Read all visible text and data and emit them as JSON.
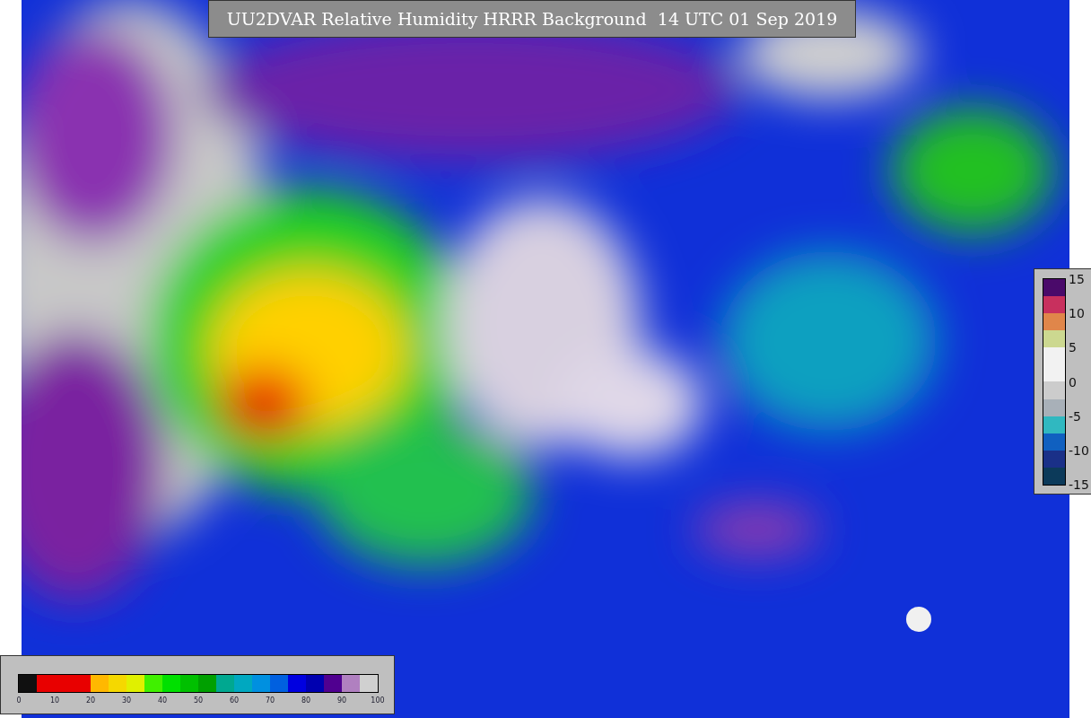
{
  "title": "UU2DVAR Relative Humidity HRRR Background  14 UTC 01 Sep 2019",
  "humidity_colorbar": {
    "segments": [
      {
        "color": "#101010"
      },
      {
        "color": "#e80000"
      },
      {
        "color": "#e80000"
      },
      {
        "color": "#e80000"
      },
      {
        "color": "#ffb800"
      },
      {
        "color": "#f5d800"
      },
      {
        "color": "#e0f000"
      },
      {
        "color": "#40f000"
      },
      {
        "color": "#00e000"
      },
      {
        "color": "#00c000"
      },
      {
        "color": "#00a000"
      },
      {
        "color": "#00a890"
      },
      {
        "color": "#00a8c0"
      },
      {
        "color": "#0090e0"
      },
      {
        "color": "#0060e0"
      },
      {
        "color": "#0000e0"
      },
      {
        "color": "#0000b0"
      },
      {
        "color": "#500090"
      },
      {
        "color": "#b080c0"
      },
      {
        "color": "#d0d0d0"
      }
    ],
    "ticks": [
      "0",
      "10",
      "20",
      "30",
      "40",
      "50",
      "60",
      "70",
      "80",
      "90",
      "100"
    ]
  },
  "difference_colorbar": {
    "segments": [
      {
        "color": "#4a0a6a"
      },
      {
        "color": "#c8305e"
      },
      {
        "color": "#e0864a"
      },
      {
        "color": "#ccd890"
      },
      {
        "color": "#f2f2f2"
      },
      {
        "color": "#f2f2f2"
      },
      {
        "color": "#cccccc"
      },
      {
        "color": "#a8b0b8"
      },
      {
        "color": "#30b8c0"
      },
      {
        "color": "#1060c0"
      },
      {
        "color": "#1a3088"
      },
      {
        "color": "#0c3a5a"
      }
    ],
    "ticks": [
      "15",
      "10",
      "5",
      "0",
      "-5",
      "-10",
      "-15"
    ]
  }
}
